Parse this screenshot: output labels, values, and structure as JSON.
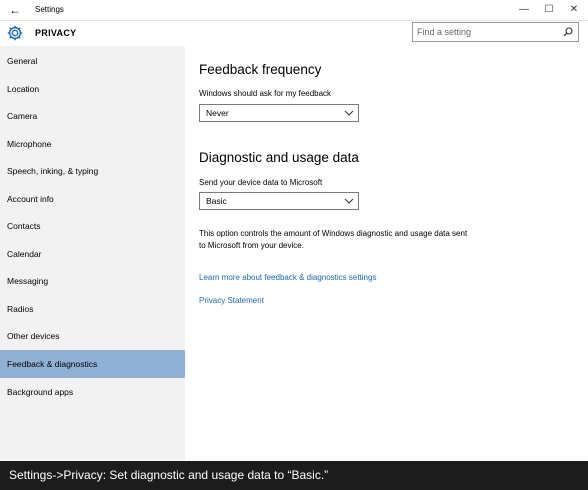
{
  "window": {
    "title": "Settings",
    "back_icon": "back-arrow-icon",
    "minimize_glyph": "—",
    "maximize_glyph": "☐",
    "close_glyph": "✕"
  },
  "header": {
    "section_title": "PRIVACY",
    "section_icon": "gear-icon",
    "search_placeholder": "Find a setting"
  },
  "sidebar": {
    "items": [
      {
        "label": "General"
      },
      {
        "label": "Location"
      },
      {
        "label": "Camera"
      },
      {
        "label": "Microphone"
      },
      {
        "label": "Speech, inking, & typing"
      },
      {
        "label": "Account info"
      },
      {
        "label": "Contacts"
      },
      {
        "label": "Calendar"
      },
      {
        "label": "Messaging"
      },
      {
        "label": "Radios"
      },
      {
        "label": "Other devices"
      },
      {
        "label": "Feedback & diagnostics"
      },
      {
        "label": "Background apps"
      }
    ],
    "selected": "Feedback & diagnostics"
  },
  "main": {
    "feedback": {
      "heading": "Feedback frequency",
      "field_label": "Windows should ask for my feedback",
      "selected_value": "Never"
    },
    "diagnostic": {
      "heading": "Diagnostic and usage data",
      "field_label": "Send your device data to Microsoft",
      "selected_value": "Basic",
      "description": "This option controls the amount of Windows diagnostic and usage data sent to Microsoft from your device."
    },
    "links": {
      "learn_more": "Learn more about feedback & diagnostics settings",
      "privacy": "Privacy Statement"
    }
  },
  "caption": "Settings->Privacy: Set diagnostic and usage data to “Basic.”",
  "colors": {
    "accent_selected": "#90b0d4",
    "link": "#1a6ab5",
    "sidebar_bg": "#f2f2f2",
    "caption_bg": "#1c1c1c"
  }
}
